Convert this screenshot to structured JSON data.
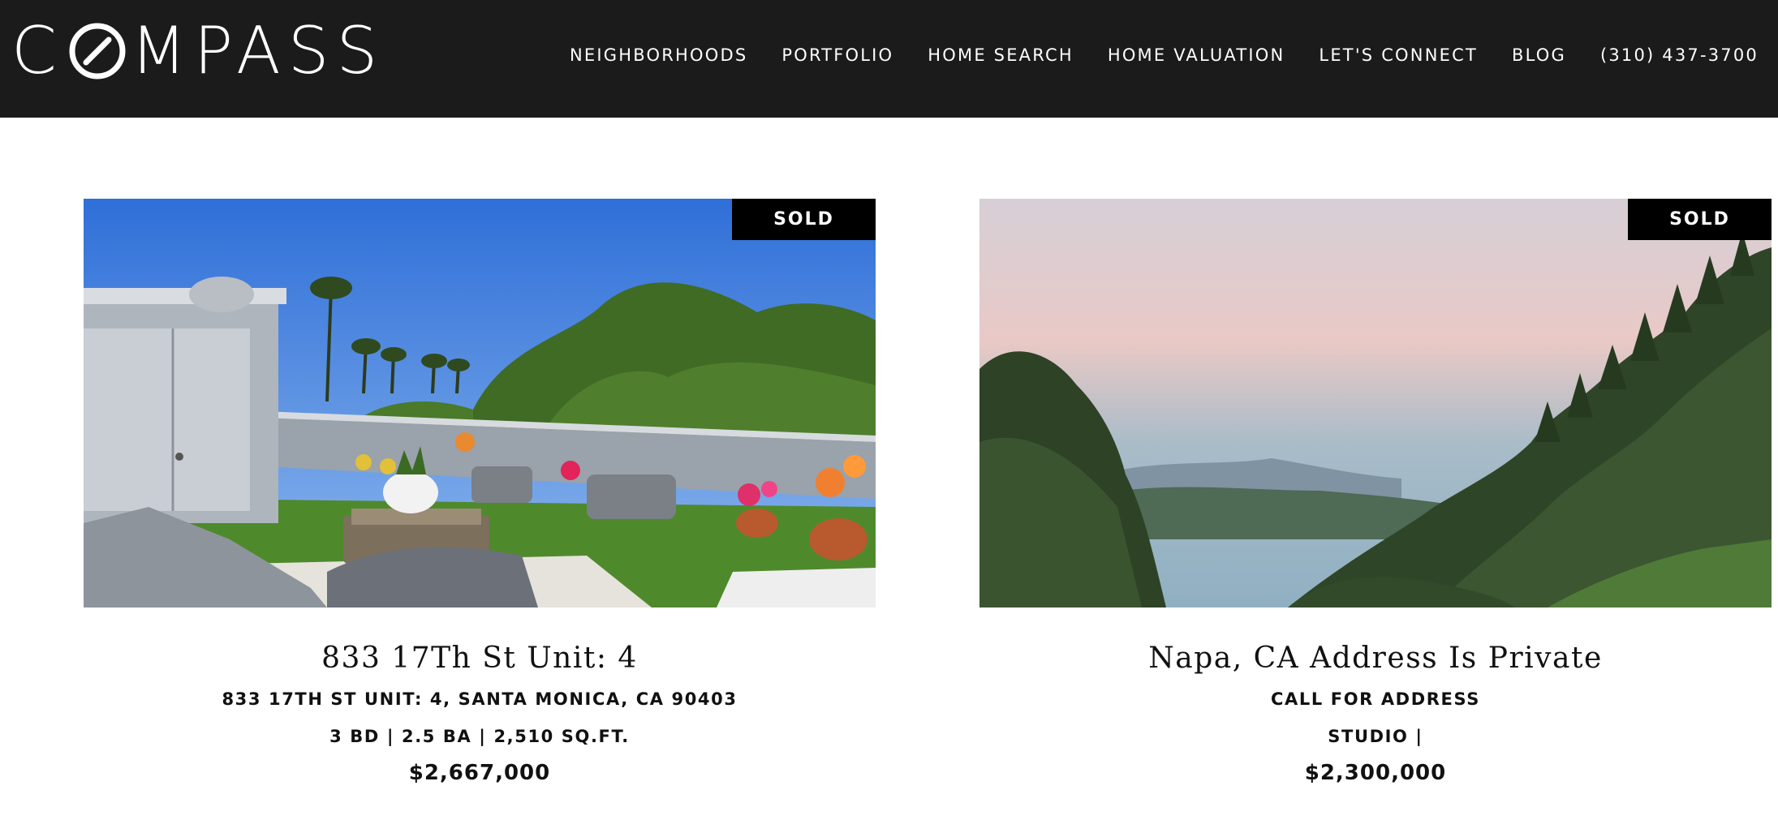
{
  "header": {
    "logo_text_before": "C",
    "logo_text_after": "MPASS",
    "logo_brand": "COMPASS",
    "nav": [
      {
        "label": "NEIGHBORHOODS"
      },
      {
        "label": "PORTFOLIO"
      },
      {
        "label": "HOME SEARCH"
      },
      {
        "label": "HOME VALUATION"
      },
      {
        "label": "LET'S CONNECT"
      },
      {
        "label": "BLOG"
      },
      {
        "label": "(310) 437-3700"
      }
    ]
  },
  "listings": [
    {
      "badge": "SOLD",
      "title": "833 17Th St Unit: 4",
      "address": "833 17TH ST UNIT: 4, SANTA MONICA, CA 90403",
      "specs": "3 BD | 2.5 BA | 2,510 SQ.FT.",
      "price": "$2,667,000",
      "photo_icon": "rooftop-patio-photo"
    },
    {
      "badge": "SOLD",
      "title": "Napa, CA Address Is Private",
      "address": "CALL FOR ADDRESS",
      "specs": "STUDIO |",
      "price": "$2,300,000",
      "photo_icon": "forest-valley-photo"
    }
  ],
  "colors": {
    "header_bg": "#1b1b1b",
    "badge_bg": "#000000",
    "text": "#111111"
  }
}
